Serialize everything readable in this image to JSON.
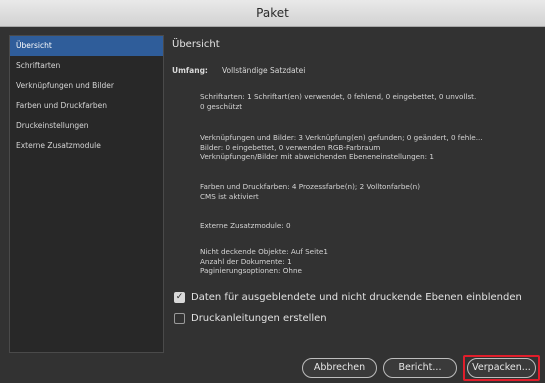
{
  "window": {
    "title": "Paket"
  },
  "sidebar": {
    "items": [
      {
        "label": "Übersicht"
      },
      {
        "label": "Schriftarten"
      },
      {
        "label": "Verknüpfungen und Bilder"
      },
      {
        "label": "Farben und Druckfarben"
      },
      {
        "label": "Druckeinstellungen"
      },
      {
        "label": "Externe Zusatzmodule"
      }
    ],
    "selected": "Übersicht"
  },
  "main": {
    "title": "Übersicht",
    "umfang_label": "Umfang:",
    "umfang_value": "Vollständige Satzdatei",
    "sections": {
      "fonts": [
        "Schriftarten: 1 Schriftart(en) verwendet, 0 fehlend, 0 eingebettet, 0 unvollst.",
        "0 geschützt"
      ],
      "links": [
        "Verknüpfungen und Bilder: 3 Verknüpfung(en) gefunden; 0 geändert, 0 fehle...",
        "Bilder: 0 eingebettet, 0 verwenden RGB-Farbraum",
        "Verknüpfungen/Bilder mit abweichenden Ebeneneinstellungen: 1"
      ],
      "colors": [
        "Farben und Druckfarben: 4 Prozessfarbe(n); 2 Volltonfarbe(n)",
        "CMS ist aktiviert"
      ],
      "plugins": [
        "Externe Zusatzmodule: 0"
      ],
      "misc": [
        "Nicht deckende Objekte: Auf Seite1",
        "Anzahl der Dokumente: 1",
        "Paginierungsoptionen: Ohne"
      ]
    }
  },
  "options": {
    "hidden_layers": {
      "label": "Daten für ausgeblendete und nicht druckende Ebenen einblenden",
      "checked": true
    },
    "instructions": {
      "label": "Druckanleitungen erstellen",
      "checked": false
    }
  },
  "buttons": {
    "cancel": "Abbrechen",
    "report": "Bericht...",
    "package": "Verpacken..."
  },
  "colors": {
    "selection": "#2f5d9a",
    "highlight": "#e01e2b"
  }
}
